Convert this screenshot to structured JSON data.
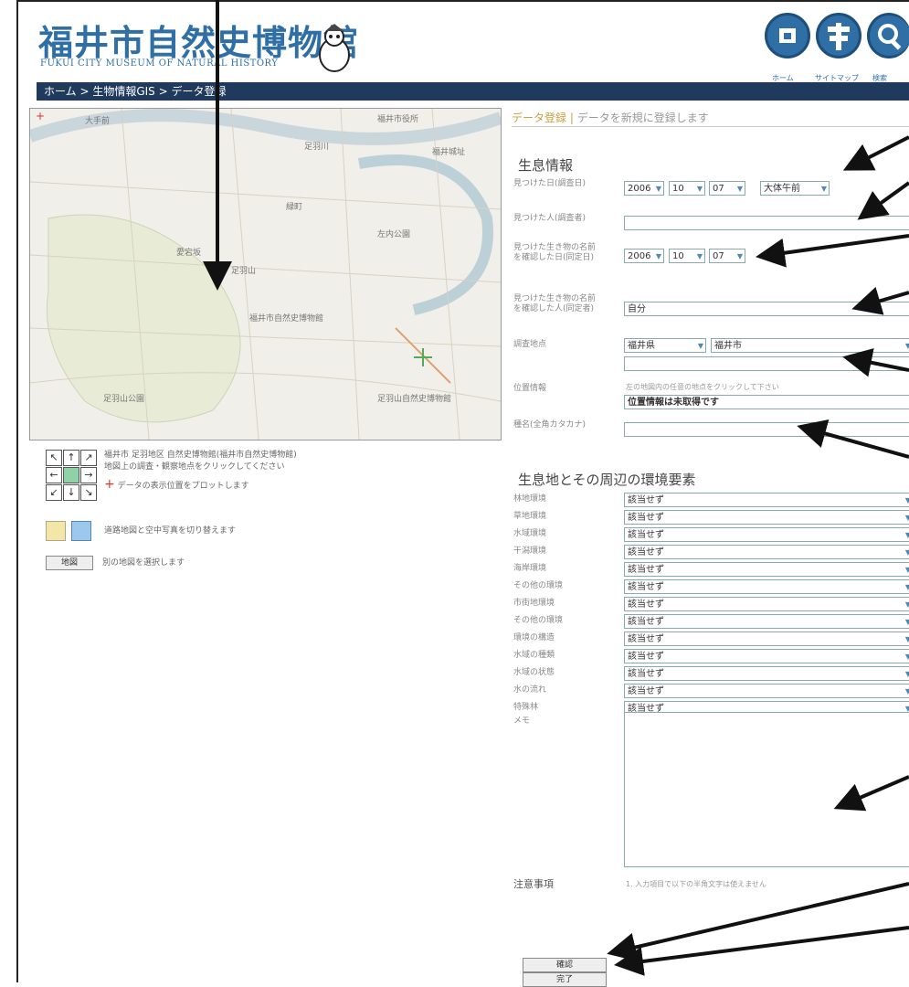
{
  "header": {
    "logo_jp": "福井市自然史博物館",
    "logo_en": "FUKUI CITY MUSEUM OF NATURAL HISTORY",
    "nav": [
      "ホーム",
      "サイトマップ",
      "検索"
    ]
  },
  "breadcrumb": "ホーム > 生物情報GIS > データ登録",
  "map": {
    "labels": [
      "大手前",
      "福井市役所",
      "足羽山",
      "福井市自然史博物館",
      "愛宕坂",
      "足羽川",
      "緑町",
      "左内公園",
      "福井城址",
      "足羽山公園",
      "足羽山自然史博物館"
    ]
  },
  "map_controls": {
    "location": "福井市 足羽地区 自然史博物館(福井市自然史博物館)",
    "hint": "地図上の調査・観察地点をクリックしてください",
    "marker_text": "データの表示位置をプロットします",
    "toggle_text": "道路地図と空中写真を切り替えます",
    "reselect_button": "地図",
    "reselect_text": "別の地図を選択します"
  },
  "form": {
    "head_title": "データ登録",
    "head_sub": "データを新規に登録します",
    "section1": "生息情報",
    "found_date_label": "見つけた日(調査日)",
    "year": "2006",
    "month": "10",
    "day": "07",
    "time": "大体午前",
    "finder_label": "見つけた人(調査者)",
    "finder_value": "",
    "id_date_label": "見つけた生き物の名前を確認した日(同定日)",
    "id_year": "2006",
    "id_month": "10",
    "id_day": "07",
    "identifier_label": "見つけた生き物の名前を確認した人(同定者)",
    "identifier_value": "自分",
    "place_label": "調査地点",
    "pref": "福井県",
    "city": "福井市",
    "position_label": "位置情報",
    "position_hint": "左の地図内の任意の地点をクリックして下さい",
    "position_value": "位置情報は未取得です",
    "species_label": "種名(全角カタカナ)",
    "section2": "生息地とその周辺の環境要素",
    "env": [
      {
        "label": "林地環境",
        "value": "該当せず"
      },
      {
        "label": "草地環境",
        "value": "該当せず"
      },
      {
        "label": "水域環境",
        "value": "該当せず"
      },
      {
        "label": "干潟環境",
        "value": "該当せず"
      },
      {
        "label": "海岸環境",
        "value": "該当せず"
      },
      {
        "label": "その他の環境",
        "value": "該当せず"
      },
      {
        "label": "市街地環境",
        "value": "該当せず"
      },
      {
        "label": "その他の環境",
        "value": "該当せず"
      },
      {
        "label": "環境の構造",
        "value": "該当せず"
      },
      {
        "label": "水域の種類",
        "value": "該当せず"
      },
      {
        "label": "水域の状態",
        "value": "該当せず"
      },
      {
        "label": "水の流れ",
        "value": "該当せず"
      },
      {
        "label": "特殊林",
        "value": "該当せず"
      }
    ],
    "memo_label": "メモ",
    "notes_label": "注意事項",
    "notes_text": "1. 入力項目で以下の半角文字は使えません",
    "confirm_button": "確認",
    "done_button": "完了"
  }
}
